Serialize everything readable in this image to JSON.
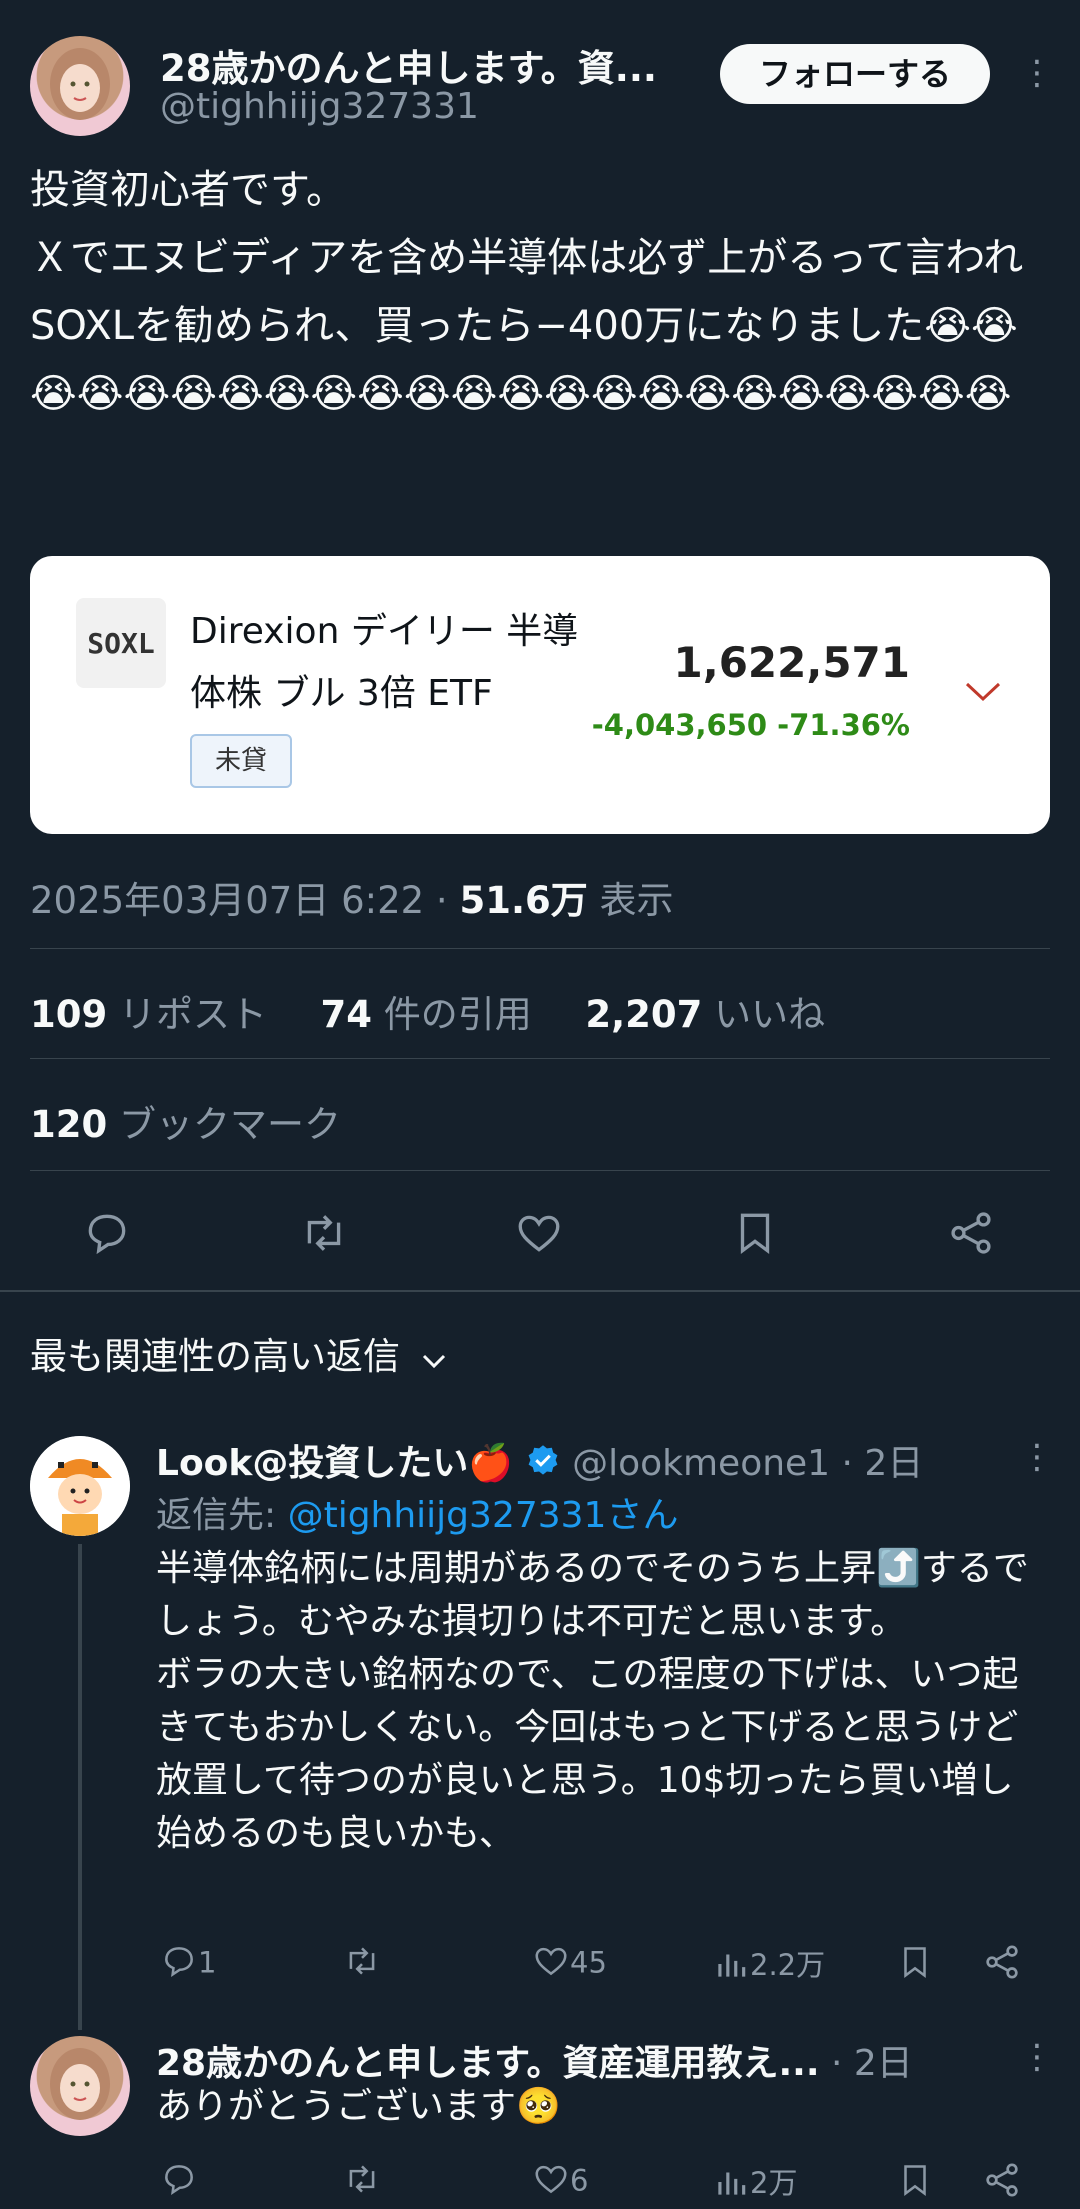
{
  "tweet": {
    "author_name": "28歳かのんと申します。資...",
    "author_handle": "@tighhiijg327331",
    "follow_label": "フォローする",
    "more_label": "⋮",
    "text": "投資初心者です。\nＸでエヌビディアを含め半導体は必ず上がるって言われSOXLを勧められ、買ったら−400万になりました😭😭😭😭😭😭😭😭😭😭😭😭😭😭😭😭😭😭😭😭😭😭😭",
    "card": {
      "logo_text": "SOXL",
      "fund_name_line1": "Direxion デイリー 半導",
      "fund_name_line2": "体株 ブル 3倍 ETF",
      "tag": "未貸",
      "value": "1,622,571",
      "change": "-4,043,650 -71.36%",
      "change_color": "#2e8b17"
    },
    "timestamp": "2025年03月07日 6:22 · ",
    "views_count": "51.6万",
    "views_label": " 表示",
    "stats": {
      "reposts_count": "109",
      "reposts_label": "リポスト",
      "quotes_count": "74",
      "quotes_label": "件の引用",
      "likes_count": "2,207",
      "likes_label": "いいね",
      "bookmarks_count": "120",
      "bookmarks_label": "ブックマーク"
    }
  },
  "replies_header": {
    "label": "最も関連性の高い返信",
    "chevron": "⌄"
  },
  "replies": [
    {
      "author_name": "Look@投資したい🍎",
      "author_handle": "@lookmeone1",
      "time": " · 2日",
      "reply_to_prefix": "返信先: ",
      "reply_to_handle": "@tighhiijg327331さん",
      "text": "半導体銘柄には周期があるのでそのうち上昇⤴️するでしょう。むやみな損切りは不可だと思います。\nボラの大きい銘柄なので、この程度の下げは、いつ起きてもおかしくない。今回はもっと下げると思うけど放置して待つのが良いと思う。10$切ったら買い増し始めるのも良いかも、",
      "replies": "1",
      "reposts": "",
      "likes": "45",
      "views": "2.2万"
    },
    {
      "author_name": "28歳かのんと申します。資産運用教え...",
      "time": " · 2日",
      "text": "ありがとうございます🥺",
      "replies": "",
      "reposts": "",
      "likes": "6",
      "views": "2万"
    }
  ],
  "colors": {
    "background": "#15202b",
    "accent": "#1d9bf0",
    "verified": "#1d9bf0",
    "down_arrow": "#c0392b"
  }
}
